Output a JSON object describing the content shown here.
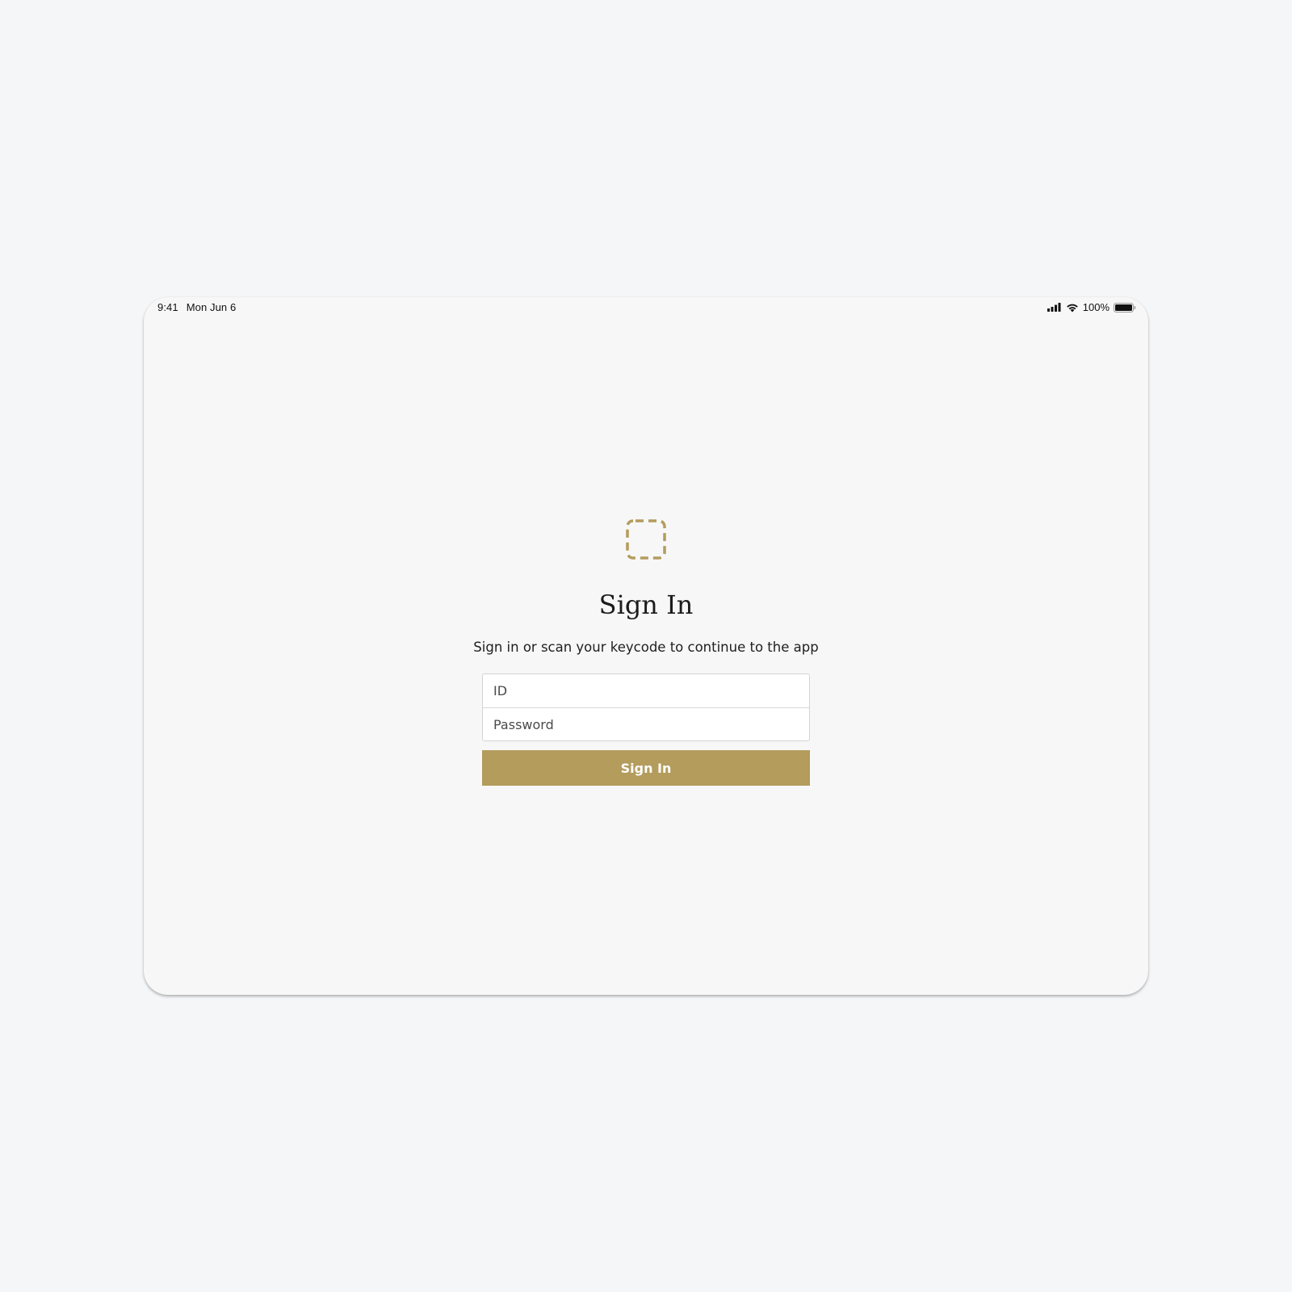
{
  "status_bar": {
    "time": "9:41",
    "date": "Mon Jun 6",
    "battery": "100%"
  },
  "icons": {
    "logo": "dashed-square-icon",
    "signal": "cellular-signal-icon",
    "wifi": "wifi-icon",
    "battery": "battery-icon"
  },
  "colors": {
    "accent": "#b39c5c",
    "background": "#f7f7f7"
  },
  "signin": {
    "title": "Sign In",
    "subtitle": "Sign in or scan your keycode to continue to the app",
    "id_placeholder": "ID",
    "password_placeholder": "Password",
    "button_label": "Sign In"
  }
}
